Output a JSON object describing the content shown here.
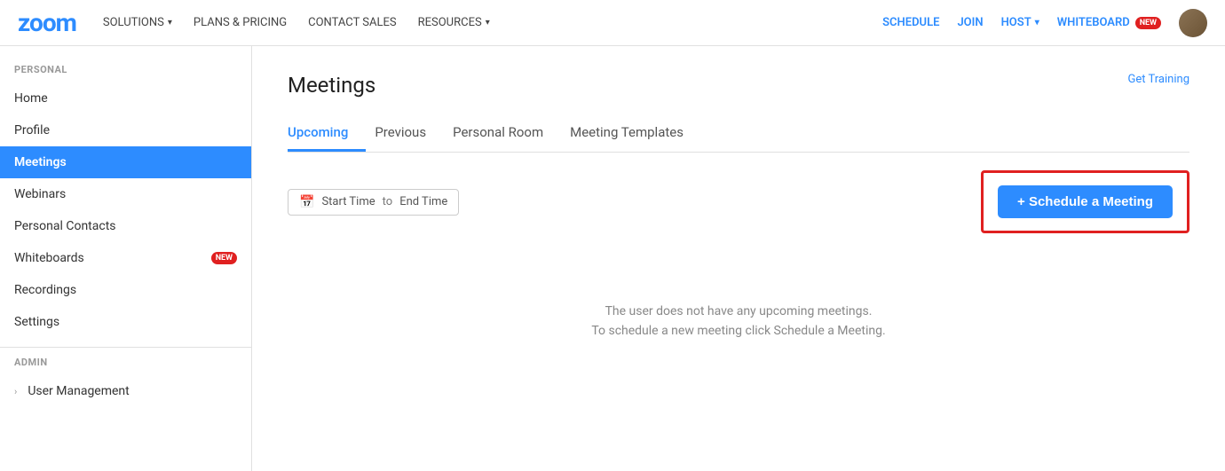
{
  "topnav": {
    "logo": "zoom",
    "left_items": [
      {
        "label": "SOLUTIONS",
        "has_dropdown": true
      },
      {
        "label": "PLANS & PRICING",
        "has_dropdown": false
      },
      {
        "label": "CONTACT SALES",
        "has_dropdown": false
      },
      {
        "label": "RESOURCES",
        "has_dropdown": true
      }
    ],
    "right_items": [
      {
        "label": "SCHEDULE",
        "type": "action"
      },
      {
        "label": "JOIN",
        "type": "action"
      },
      {
        "label": "HOST",
        "type": "action",
        "has_dropdown": true
      },
      {
        "label": "WHITEBOARD",
        "type": "action",
        "badge": "NEW"
      }
    ]
  },
  "sidebar": {
    "personal_label": "PERSONAL",
    "personal_items": [
      {
        "label": "Home",
        "active": false
      },
      {
        "label": "Profile",
        "active": false
      },
      {
        "label": "Meetings",
        "active": true
      },
      {
        "label": "Webinars",
        "active": false
      },
      {
        "label": "Personal Contacts",
        "active": false
      },
      {
        "label": "Whiteboards",
        "active": false,
        "badge": "NEW"
      },
      {
        "label": "Recordings",
        "active": false
      },
      {
        "label": "Settings",
        "active": false
      }
    ],
    "admin_label": "ADMIN",
    "admin_items": [
      {
        "label": "User Management",
        "has_chevron": true
      }
    ]
  },
  "page": {
    "title": "Meetings",
    "get_training_label": "Get Training",
    "tabs": [
      {
        "label": "Upcoming",
        "active": true
      },
      {
        "label": "Previous",
        "active": false
      },
      {
        "label": "Personal Room",
        "active": false
      },
      {
        "label": "Meeting Templates",
        "active": false
      }
    ],
    "date_filter": {
      "start_placeholder": "Start Time",
      "separator": "to",
      "end_placeholder": "End Time"
    },
    "schedule_button_label": "+ Schedule a Meeting",
    "empty_state": {
      "line1": "The user does not have any upcoming meetings.",
      "line2": "To schedule a new meeting click Schedule a Meeting."
    }
  }
}
